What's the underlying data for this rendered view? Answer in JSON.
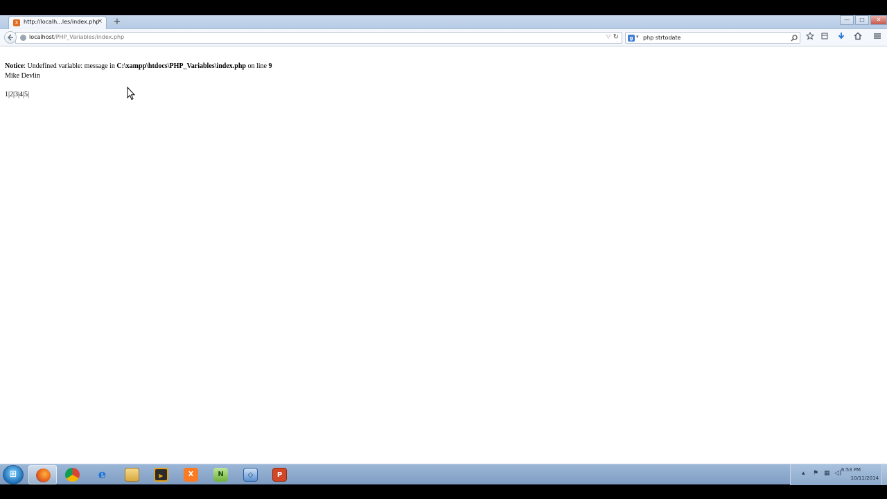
{
  "browser": {
    "tab": {
      "title": "http://localh...les/index.php",
      "close": "×"
    },
    "new_tab": "+",
    "window_controls": {
      "minimize": "—",
      "maximize": "□",
      "close": "✕"
    },
    "address": {
      "host": "localhost",
      "path": "/PHP_Variables/index.php",
      "dropdown": "▽",
      "reload": "↻"
    },
    "search": {
      "engine_letter": "g",
      "caret": "▾",
      "value": "php strtodate",
      "go": "⚲"
    },
    "toolbar_icons": [
      "star-icon",
      "bookmarks-icon",
      "download-icon",
      "home-icon",
      "menu-icon"
    ]
  },
  "page": {
    "notice": {
      "label": "Notice",
      "text1": ": Undefined variable: message in ",
      "path": "C:\\xampp\\htdocs\\PHP_Variables\\index.php",
      "text2": " on line ",
      "line_number": "9"
    },
    "name": "Mike Devlin",
    "numbers": "1|2|3|4|5|"
  },
  "taskbar": {
    "apps": [
      "firefox",
      "chrome",
      "internet-explorer",
      "file-explorer",
      "media-player",
      "xampp",
      "notepad-plus-plus",
      "virtualbox",
      "powerpoint"
    ],
    "active_app": "firefox",
    "clock": {
      "time": "6:53 PM",
      "date": "10/11/2014"
    }
  },
  "colors": {
    "titlebar": "#c2d4ea",
    "taskbar": "#8eabcd",
    "page_background": "#ffffff"
  }
}
